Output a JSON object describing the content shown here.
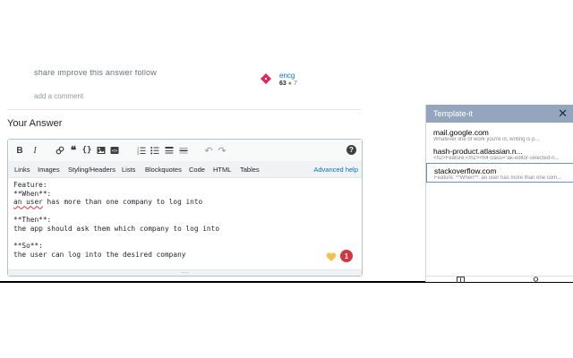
{
  "comments": {
    "top_cut_text": "share   improve this answer   follow",
    "add_comment": "add a comment"
  },
  "user": {
    "name": "encg",
    "reputation": "63",
    "bronze_count": "7",
    "avatar_icon": "identicon"
  },
  "answer_section": {
    "title": "Your Answer"
  },
  "editor": {
    "toolbar": [
      {
        "name": "bold-button",
        "label": "B",
        "icon": "bold-icon"
      },
      {
        "name": "italic-button",
        "label": "I",
        "icon": "italic-icon"
      },
      {
        "name": "link-button",
        "label": "🔗",
        "icon": "link-icon"
      },
      {
        "name": "blockquote-button",
        "label": "❝",
        "icon": "blockquote-icon"
      },
      {
        "name": "code-button",
        "label": "{}",
        "icon": "code-icon"
      },
      {
        "name": "image-button",
        "label": "▣",
        "icon": "image-icon"
      },
      {
        "name": "snippet-button",
        "label": "▤",
        "icon": "snippet-icon"
      },
      {
        "name": "numbered-list-button",
        "label": "≔",
        "icon": "ordered-list-icon"
      },
      {
        "name": "bulleted-list-button",
        "label": "☰",
        "icon": "bullet-list-icon"
      },
      {
        "name": "heading-button",
        "label": "≡",
        "icon": "heading-icon"
      },
      {
        "name": "hr-button",
        "label": "▬",
        "icon": "horizontal-rule-icon"
      },
      {
        "name": "undo-button",
        "label": "↶",
        "icon": "undo-icon"
      },
      {
        "name": "redo-button",
        "label": "↷",
        "icon": "redo-icon"
      },
      {
        "name": "help-button",
        "label": "?",
        "icon": "help-icon"
      }
    ],
    "help_links": [
      "Links",
      "Images",
      "Styling/Headers",
      "Lists",
      "Blockquotes",
      "Code",
      "HTML",
      "Tables"
    ],
    "advanced_help": "Advanced help",
    "content": {
      "line1": "Feature:",
      "line2": "**When**:",
      "line3_err": "an user",
      "line3_rest": " has more than one company to log into",
      "line4": "",
      "line5": "**Then**:",
      "line6": "the app should ask them which company to log into",
      "line7": "",
      "line8": "**So**:",
      "line9": "the user can log into the desired company"
    },
    "badge_count": "1",
    "grip": "....."
  },
  "template_panel": {
    "title": "Template-it",
    "close_label": "✕",
    "items": [
      {
        "title": "mail.google.com",
        "preview": "Whatever line of work you're in, writing is p..."
      },
      {
        "title": "hash-product.atlassian.n...",
        "preview": "<h2>Feature:</h2><h4 class=\"ak-editor-selected-n..."
      },
      {
        "title": "stackoverflow.com",
        "preview": "Feature: **When**: an user has more than one com..."
      }
    ],
    "footer_icons": [
      "add-template-icon",
      "lock-icon"
    ]
  },
  "colors": {
    "panel_header": "#94a6be",
    "link": "#0077cc",
    "badge": "#d1383d",
    "selected_border": "#6a8fc6"
  }
}
